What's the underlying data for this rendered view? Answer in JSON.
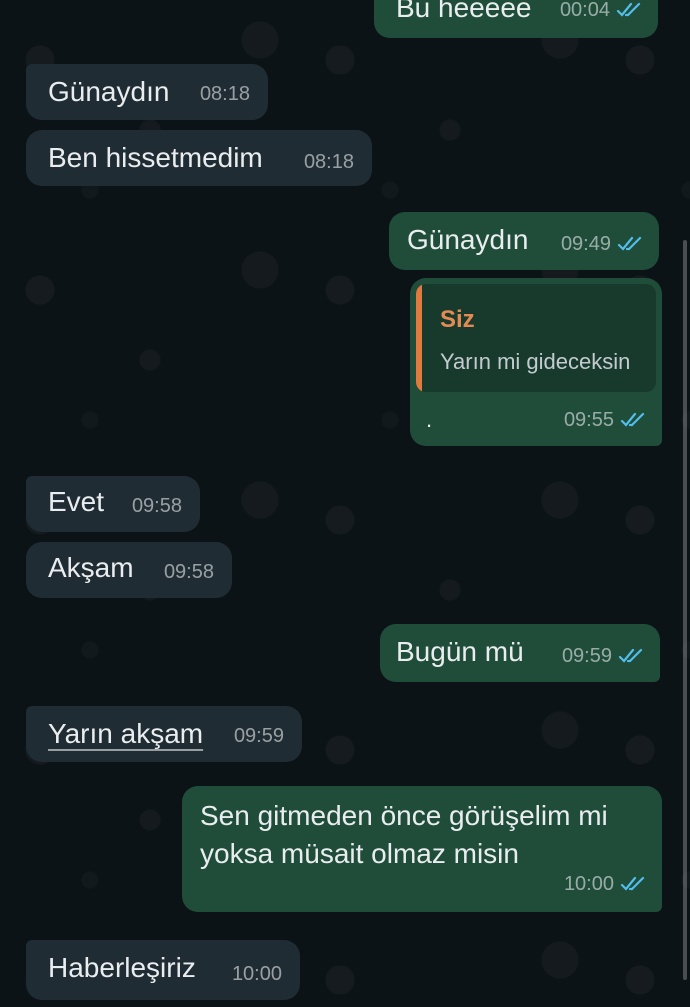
{
  "messages": [
    {
      "id": "m1",
      "dir": "out",
      "text": "Bu heeeee",
      "time": "00:04",
      "read": true
    },
    {
      "id": "m2",
      "dir": "in",
      "text": "Günaydın",
      "time": "08:18"
    },
    {
      "id": "m3",
      "dir": "in",
      "text": "Ben hissetmedim",
      "time": "08:18"
    },
    {
      "id": "m4",
      "dir": "out",
      "text": "Günaydın",
      "time": "09:49",
      "read": true
    },
    {
      "id": "m5",
      "dir": "out",
      "quote_author": "Siz",
      "quote_text": "Yarın mi gideceksin",
      "text": ".",
      "time": "09:55",
      "read": true
    },
    {
      "id": "m6",
      "dir": "in",
      "text": "Evet",
      "time": "09:58"
    },
    {
      "id": "m7",
      "dir": "in",
      "text": "Akşam",
      "time": "09:58"
    },
    {
      "id": "m8",
      "dir": "out",
      "text": "Bugün mü",
      "time": "09:59",
      "read": true
    },
    {
      "id": "m9",
      "dir": "in",
      "text": "Yarın akşam",
      "time": "09:59"
    },
    {
      "id": "m10",
      "dir": "out",
      "text_line1": "Sen gitmeden önce görüşelim mi",
      "text_line2": "yoksa müsait olmaz misin",
      "time": "10:00",
      "read": true
    },
    {
      "id": "m11",
      "dir": "in",
      "text": "Haberleşiriz",
      "time": "10:00"
    }
  ],
  "colors": {
    "incoming": "#202c33",
    "outgoing": "#1f4d3a",
    "read_ticks": "#53bdeb",
    "quote_accent": "#e07a3e"
  }
}
